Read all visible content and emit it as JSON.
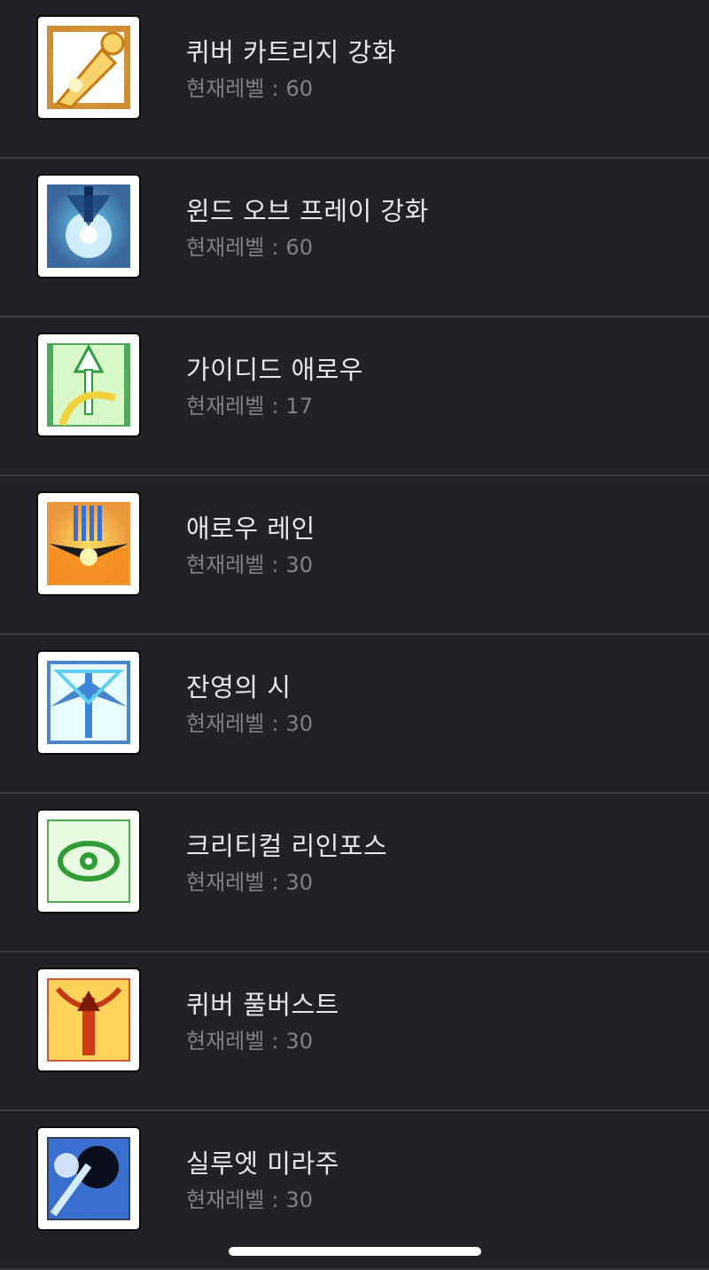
{
  "level_prefix": "현재레벨",
  "level_sep": ":",
  "skills": [
    {
      "name": "퀴버 카트리지 강화",
      "level": "60",
      "icon": "quiver-cartridge-icon",
      "colors": [
        "#f7d36b",
        "#c87a10"
      ]
    },
    {
      "name": "윈드 오브 프레이 강화",
      "level": "60",
      "icon": "wind-of-frey-icon",
      "colors": [
        "#4fc3f0",
        "#1a4d8f"
      ]
    },
    {
      "name": "가이디드 애로우",
      "level": "17",
      "icon": "guided-arrow-icon",
      "colors": [
        "#8fe07a",
        "#2e9a3e"
      ]
    },
    {
      "name": "애로우 레인",
      "level": "30",
      "icon": "arrow-rain-icon",
      "colors": [
        "#ffd84a",
        "#e8861a"
      ]
    },
    {
      "name": "잔영의 시",
      "level": "30",
      "icon": "afterimage-arrow-icon",
      "colors": [
        "#9fe4f6",
        "#2a6fc4"
      ]
    },
    {
      "name": "크리티컬 리인포스",
      "level": "30",
      "icon": "critical-reinforce-icon",
      "colors": [
        "#7fd86a",
        "#2f9c34"
      ]
    },
    {
      "name": "퀴버 풀버스트",
      "level": "30",
      "icon": "quiver-full-burst-icon",
      "colors": [
        "#ffb13d",
        "#c43a14"
      ]
    },
    {
      "name": "실루엣 미라주",
      "level": "30",
      "icon": "silhouette-mirage-icon",
      "colors": [
        "#4d9ae6",
        "#0e1f3a"
      ]
    }
  ]
}
